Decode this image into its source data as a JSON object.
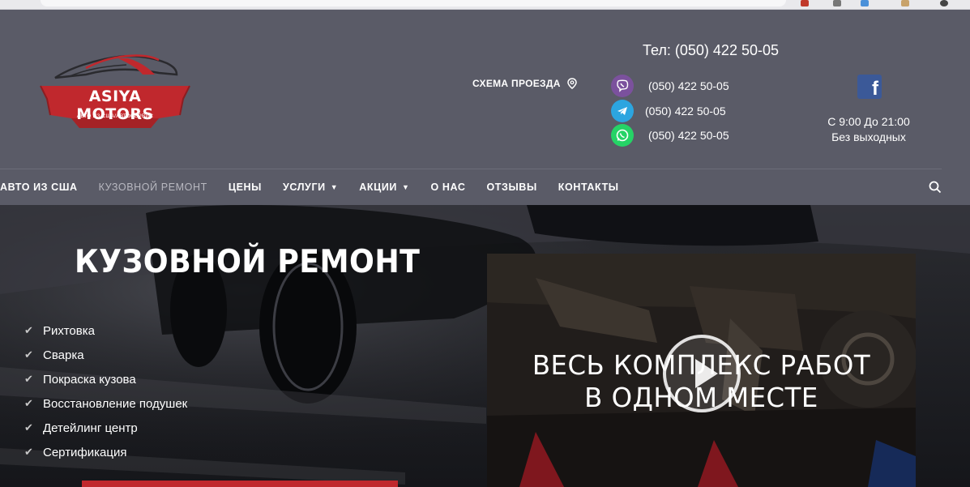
{
  "header": {
    "logo": {
      "name": "ASIYA MOTORS",
      "tagline": "АВТО ИЗ США/АВТОСЕРВИС"
    },
    "tel": "Тел: (050) 422 50-05",
    "route_label": "СХЕМА ПРОЕЗДА",
    "messengers": [
      {
        "icon": "viber-icon",
        "number": "(050) 422 50-05",
        "color": "#7b519d"
      },
      {
        "icon": "telegram-icon",
        "number": "(050) 422 50-05",
        "color": "#2ca5e0"
      },
      {
        "icon": "whatsapp-icon",
        "number": "(050) 422 50-05",
        "color": "#25d366"
      }
    ],
    "facebook_letter": "f",
    "hours_line1": "С 9:00 До 21:00",
    "hours_line2": "Без выходных"
  },
  "nav": {
    "items": [
      {
        "label": "АВТО ИЗ США",
        "dropdown": false,
        "active": false
      },
      {
        "label": "КУЗОВНОЙ РЕМОНТ",
        "dropdown": false,
        "active": true
      },
      {
        "label": "ЦЕНЫ",
        "dropdown": false,
        "active": false
      },
      {
        "label": "УСЛУГИ",
        "dropdown": true,
        "active": false
      },
      {
        "label": "АКЦИИ",
        "dropdown": true,
        "active": false
      },
      {
        "label": "О НАС",
        "dropdown": false,
        "active": false
      },
      {
        "label": "ОТЗЫВЫ",
        "dropdown": false,
        "active": false
      },
      {
        "label": "КОНТАКТЫ",
        "dropdown": false,
        "active": false
      }
    ],
    "search_icon": "search-icon"
  },
  "hero": {
    "title": "КУЗОВНОЙ РЕМОНТ",
    "services": [
      "Рихтовка",
      "Сварка",
      "Покраска кузова",
      "Восстановление подушек",
      "Детейлинг центр",
      "Сертификация"
    ],
    "video_line1": "ВЕСЬ КОМПЛЕКС РАБОТ",
    "video_line2": "В ОДНОМ МЕСТЕ"
  },
  "colors": {
    "header_bg": "#5a5b67",
    "accent_red": "#c0282d",
    "facebook_blue": "#3b5998"
  }
}
